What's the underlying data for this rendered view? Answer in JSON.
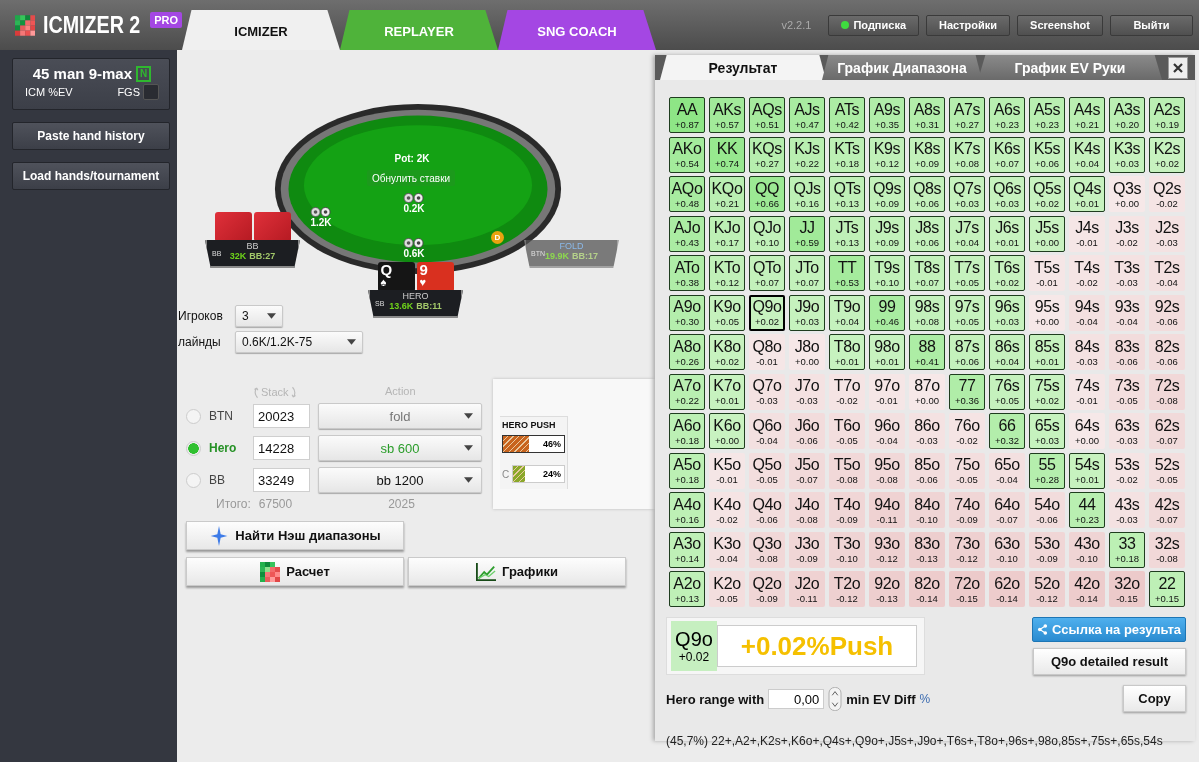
{
  "app": {
    "logo": "ICMIZER 2",
    "badge": "PRO",
    "version": "v2.2.1"
  },
  "main_tabs": [
    {
      "label": "ICMIZER",
      "selected": true,
      "color": "#f0f0f0"
    },
    {
      "label": "REPLAYER",
      "selected": false,
      "color": "#4fb33a"
    },
    {
      "label": "SNG COACH",
      "selected": false,
      "color": "#a447e3"
    }
  ],
  "top_buttons": [
    {
      "label": "Подписка",
      "kind": "status"
    },
    {
      "label": "Настройки",
      "kind": "plain"
    },
    {
      "label": "Screenshot",
      "kind": "plain"
    },
    {
      "label": "Выйти",
      "kind": "plain"
    }
  ],
  "sidebar": {
    "format": {
      "title": "45 man 9-max",
      "badge": "N",
      "subtitle": "ICM %EV",
      "fgs_label": "FGS",
      "fgs_checked": false
    },
    "buttons": [
      "Paste hand history",
      "Load hands/tournament"
    ]
  },
  "table": {
    "pot": "Pot: 2K",
    "reset_button": "Обнулить ставки",
    "dealer": "D",
    "bets": [
      {
        "amount": "1.2K"
      },
      {
        "amount": "0.2K"
      },
      {
        "amount": "0.6K"
      }
    ],
    "seats": [
      {
        "position": "BB",
        "name": "BB",
        "stack": "32K",
        "bb": "BB:27",
        "folded": false,
        "cards": [
          {
            "face_up": false
          },
          {
            "face_up": false
          }
        ]
      },
      {
        "position": "BTN",
        "name": "FOLD",
        "stack": "19.9K",
        "bb": "BB:17",
        "folded": true
      },
      {
        "position": "SB",
        "name": "HERO",
        "stack": "13.6K",
        "bb": "BB:11",
        "folded": false,
        "cards": [
          {
            "face_up": true,
            "rank": "Q",
            "suit": "♠",
            "color": "#151515"
          },
          {
            "face_up": true,
            "rank": "9",
            "suit": "♥",
            "color": "#d9301f"
          }
        ]
      }
    ]
  },
  "settings": [
    {
      "label": "Игроков",
      "value": "3",
      "kind": "short"
    },
    {
      "label": "лайнды",
      "value": "0.6K/1.2K-75",
      "kind": "wide"
    }
  ],
  "players_form": {
    "stack_header": "Stack",
    "action_header": "Action",
    "players": [
      {
        "name": "BTN",
        "selected": false,
        "stack": "20023",
        "action": "fold",
        "disabled": true
      },
      {
        "name": "Hero",
        "selected": true,
        "stack": "14228",
        "action": "sb 600",
        "disabled": false
      },
      {
        "name": "BB",
        "selected": false,
        "stack": "33249",
        "action": "bb 1200",
        "disabled": false
      }
    ],
    "totals_label": "Итого:",
    "total_stack": "67500",
    "total_action": "2025"
  },
  "range_legend": {
    "title": "HERO PUSH",
    "bars": [
      {
        "value": "46%",
        "color": "#c8641e"
      },
      {
        "label": "C",
        "value": "24%",
        "color": "#8aa82a"
      }
    ]
  },
  "actions": [
    {
      "label": "Найти Нэш диапазоны",
      "kind": "nash"
    },
    {
      "label": "Расчет",
      "kind": "calc"
    },
    {
      "label": "Графики",
      "kind": "charts"
    }
  ],
  "result_tabs": [
    {
      "label": "Результат",
      "selected": true
    },
    {
      "label": "График Диапазона",
      "selected": false
    },
    {
      "label": "График EV Руки",
      "selected": false
    }
  ],
  "grid": {
    "rows": [
      [
        {
          "hand": "AA",
          "ev": "+0.87",
          "push": true,
          "selected": false
        },
        {
          "hand": "AKs",
          "ev": "+0.57",
          "push": true,
          "selected": false
        },
        {
          "hand": "AQs",
          "ev": "+0.51",
          "push": true,
          "selected": false
        },
        {
          "hand": "AJs",
          "ev": "+0.47",
          "push": true,
          "selected": false
        },
        {
          "hand": "ATs",
          "ev": "+0.42",
          "push": true,
          "selected": false
        },
        {
          "hand": "A9s",
          "ev": "+0.35",
          "push": true,
          "selected": false
        },
        {
          "hand": "A8s",
          "ev": "+0.31",
          "push": true,
          "selected": false
        },
        {
          "hand": "A7s",
          "ev": "+0.27",
          "push": true,
          "selected": false
        },
        {
          "hand": "A6s",
          "ev": "+0.23",
          "push": true,
          "selected": false
        },
        {
          "hand": "A5s",
          "ev": "+0.23",
          "push": true,
          "selected": false
        },
        {
          "hand": "A4s",
          "ev": "+0.21",
          "push": true,
          "selected": false
        },
        {
          "hand": "A3s",
          "ev": "+0.20",
          "push": true,
          "selected": false
        },
        {
          "hand": "A2s",
          "ev": "+0.19",
          "push": true,
          "selected": false
        }
      ],
      [
        {
          "hand": "AKo",
          "ev": "+0.54",
          "push": true,
          "selected": false
        },
        {
          "hand": "KK",
          "ev": "+0.74",
          "push": true,
          "selected": false
        },
        {
          "hand": "KQs",
          "ev": "+0.27",
          "push": true,
          "selected": false
        },
        {
          "hand": "KJs",
          "ev": "+0.22",
          "push": true,
          "selected": false
        },
        {
          "hand": "KTs",
          "ev": "+0.18",
          "push": true,
          "selected": false
        },
        {
          "hand": "K9s",
          "ev": "+0.12",
          "push": true,
          "selected": false
        },
        {
          "hand": "K8s",
          "ev": "+0.09",
          "push": true,
          "selected": false
        },
        {
          "hand": "K7s",
          "ev": "+0.08",
          "push": true,
          "selected": false
        },
        {
          "hand": "K6s",
          "ev": "+0.07",
          "push": true,
          "selected": false
        },
        {
          "hand": "K5s",
          "ev": "+0.06",
          "push": true,
          "selected": false
        },
        {
          "hand": "K4s",
          "ev": "+0.04",
          "push": true,
          "selected": false
        },
        {
          "hand": "K3s",
          "ev": "+0.03",
          "push": true,
          "selected": false
        },
        {
          "hand": "K2s",
          "ev": "+0.02",
          "push": true,
          "selected": false
        }
      ],
      [
        {
          "hand": "AQo",
          "ev": "+0.48",
          "push": true,
          "selected": false
        },
        {
          "hand": "KQo",
          "ev": "+0.21",
          "push": true,
          "selected": false
        },
        {
          "hand": "QQ",
          "ev": "+0.66",
          "push": true,
          "selected": false
        },
        {
          "hand": "QJs",
          "ev": "+0.16",
          "push": true,
          "selected": false
        },
        {
          "hand": "QTs",
          "ev": "+0.13",
          "push": true,
          "selected": false
        },
        {
          "hand": "Q9s",
          "ev": "+0.09",
          "push": true,
          "selected": false
        },
        {
          "hand": "Q8s",
          "ev": "+0.06",
          "push": true,
          "selected": false
        },
        {
          "hand": "Q7s",
          "ev": "+0.03",
          "push": true,
          "selected": false
        },
        {
          "hand": "Q6s",
          "ev": "+0.03",
          "push": true,
          "selected": false
        },
        {
          "hand": "Q5s",
          "ev": "+0.02",
          "push": true,
          "selected": false
        },
        {
          "hand": "Q4s",
          "ev": "+0.01",
          "push": true,
          "selected": false
        },
        {
          "hand": "Q3s",
          "ev": "+0.00",
          "push": false,
          "selected": false
        },
        {
          "hand": "Q2s",
          "ev": "-0.02",
          "push": false,
          "selected": false
        }
      ],
      [
        {
          "hand": "AJo",
          "ev": "+0.43",
          "push": true,
          "selected": false
        },
        {
          "hand": "KJo",
          "ev": "+0.17",
          "push": true,
          "selected": false
        },
        {
          "hand": "QJo",
          "ev": "+0.10",
          "push": true,
          "selected": false
        },
        {
          "hand": "JJ",
          "ev": "+0.59",
          "push": true,
          "selected": false
        },
        {
          "hand": "JTs",
          "ev": "+0.13",
          "push": true,
          "selected": false
        },
        {
          "hand": "J9s",
          "ev": "+0.09",
          "push": true,
          "selected": false
        },
        {
          "hand": "J8s",
          "ev": "+0.06",
          "push": true,
          "selected": false
        },
        {
          "hand": "J7s",
          "ev": "+0.04",
          "push": true,
          "selected": false
        },
        {
          "hand": "J6s",
          "ev": "+0.01",
          "push": true,
          "selected": false
        },
        {
          "hand": "J5s",
          "ev": "+0.00",
          "push": true,
          "selected": false
        },
        {
          "hand": "J4s",
          "ev": "-0.01",
          "push": false,
          "selected": false
        },
        {
          "hand": "J3s",
          "ev": "-0.02",
          "push": false,
          "selected": false
        },
        {
          "hand": "J2s",
          "ev": "-0.03",
          "push": false,
          "selected": false
        }
      ],
      [
        {
          "hand": "ATo",
          "ev": "+0.38",
          "push": true,
          "selected": false
        },
        {
          "hand": "KTo",
          "ev": "+0.12",
          "push": true,
          "selected": false
        },
        {
          "hand": "QTo",
          "ev": "+0.07",
          "push": true,
          "selected": false
        },
        {
          "hand": "JTo",
          "ev": "+0.07",
          "push": true,
          "selected": false
        },
        {
          "hand": "TT",
          "ev": "+0.53",
          "push": true,
          "selected": false
        },
        {
          "hand": "T9s",
          "ev": "+0.10",
          "push": true,
          "selected": false
        },
        {
          "hand": "T8s",
          "ev": "+0.07",
          "push": true,
          "selected": false
        },
        {
          "hand": "T7s",
          "ev": "+0.05",
          "push": true,
          "selected": false
        },
        {
          "hand": "T6s",
          "ev": "+0.02",
          "push": true,
          "selected": false
        },
        {
          "hand": "T5s",
          "ev": "-0.01",
          "push": false,
          "selected": false
        },
        {
          "hand": "T4s",
          "ev": "-0.02",
          "push": false,
          "selected": false
        },
        {
          "hand": "T3s",
          "ev": "-0.03",
          "push": false,
          "selected": false
        },
        {
          "hand": "T2s",
          "ev": "-0.04",
          "push": false,
          "selected": false
        }
      ],
      [
        {
          "hand": "A9o",
          "ev": "+0.30",
          "push": true,
          "selected": false
        },
        {
          "hand": "K9o",
          "ev": "+0.05",
          "push": true,
          "selected": false
        },
        {
          "hand": "Q9o",
          "ev": "+0.02",
          "push": true,
          "selected": true
        },
        {
          "hand": "J9o",
          "ev": "+0.03",
          "push": true,
          "selected": false
        },
        {
          "hand": "T9o",
          "ev": "+0.04",
          "push": true,
          "selected": false
        },
        {
          "hand": "99",
          "ev": "+0.46",
          "push": true,
          "selected": false
        },
        {
          "hand": "98s",
          "ev": "+0.08",
          "push": true,
          "selected": false
        },
        {
          "hand": "97s",
          "ev": "+0.05",
          "push": true,
          "selected": false
        },
        {
          "hand": "96s",
          "ev": "+0.03",
          "push": true,
          "selected": false
        },
        {
          "hand": "95s",
          "ev": "+0.00",
          "push": false,
          "selected": false
        },
        {
          "hand": "94s",
          "ev": "-0.04",
          "push": false,
          "selected": false
        },
        {
          "hand": "93s",
          "ev": "-0.04",
          "push": false,
          "selected": false
        },
        {
          "hand": "92s",
          "ev": "-0.06",
          "push": false,
          "selected": false
        }
      ],
      [
        {
          "hand": "A8o",
          "ev": "+0.26",
          "push": true,
          "selected": false
        },
        {
          "hand": "K8o",
          "ev": "+0.02",
          "push": true,
          "selected": false
        },
        {
          "hand": "Q8o",
          "ev": "-0.01",
          "push": false,
          "selected": false
        },
        {
          "hand": "J8o",
          "ev": "+0.00",
          "push": false,
          "selected": false
        },
        {
          "hand": "T8o",
          "ev": "+0.01",
          "push": true,
          "selected": false
        },
        {
          "hand": "98o",
          "ev": "+0.01",
          "push": true,
          "selected": false
        },
        {
          "hand": "88",
          "ev": "+0.41",
          "push": true,
          "selected": false
        },
        {
          "hand": "87s",
          "ev": "+0.06",
          "push": true,
          "selected": false
        },
        {
          "hand": "86s",
          "ev": "+0.04",
          "push": true,
          "selected": false
        },
        {
          "hand": "85s",
          "ev": "+0.01",
          "push": true,
          "selected": false
        },
        {
          "hand": "84s",
          "ev": "-0.03",
          "push": false,
          "selected": false
        },
        {
          "hand": "83s",
          "ev": "-0.06",
          "push": false,
          "selected": false
        },
        {
          "hand": "82s",
          "ev": "-0.06",
          "push": false,
          "selected": false
        }
      ],
      [
        {
          "hand": "A7o",
          "ev": "+0.22",
          "push": true,
          "selected": false
        },
        {
          "hand": "K7o",
          "ev": "+0.01",
          "push": true,
          "selected": false
        },
        {
          "hand": "Q7o",
          "ev": "-0.03",
          "push": false,
          "selected": false
        },
        {
          "hand": "J7o",
          "ev": "-0.03",
          "push": false,
          "selected": false
        },
        {
          "hand": "T7o",
          "ev": "-0.02",
          "push": false,
          "selected": false
        },
        {
          "hand": "97o",
          "ev": "-0.01",
          "push": false,
          "selected": false
        },
        {
          "hand": "87o",
          "ev": "+0.00",
          "push": false,
          "selected": false
        },
        {
          "hand": "77",
          "ev": "+0.36",
          "push": true,
          "selected": false
        },
        {
          "hand": "76s",
          "ev": "+0.05",
          "push": true,
          "selected": false
        },
        {
          "hand": "75s",
          "ev": "+0.02",
          "push": true,
          "selected": false
        },
        {
          "hand": "74s",
          "ev": "-0.01",
          "push": false,
          "selected": false
        },
        {
          "hand": "73s",
          "ev": "-0.05",
          "push": false,
          "selected": false
        },
        {
          "hand": "72s",
          "ev": "-0.08",
          "push": false,
          "selected": false
        }
      ],
      [
        {
          "hand": "A6o",
          "ev": "+0.18",
          "push": true,
          "selected": false
        },
        {
          "hand": "K6o",
          "ev": "+0.00",
          "push": true,
          "selected": false
        },
        {
          "hand": "Q6o",
          "ev": "-0.04",
          "push": false,
          "selected": false
        },
        {
          "hand": "J6o",
          "ev": "-0.06",
          "push": false,
          "selected": false
        },
        {
          "hand": "T6o",
          "ev": "-0.05",
          "push": false,
          "selected": false
        },
        {
          "hand": "96o",
          "ev": "-0.04",
          "push": false,
          "selected": false
        },
        {
          "hand": "86o",
          "ev": "-0.03",
          "push": false,
          "selected": false
        },
        {
          "hand": "76o",
          "ev": "-0.02",
          "push": false,
          "selected": false
        },
        {
          "hand": "66",
          "ev": "+0.32",
          "push": true,
          "selected": false
        },
        {
          "hand": "65s",
          "ev": "+0.03",
          "push": true,
          "selected": false
        },
        {
          "hand": "64s",
          "ev": "+0.00",
          "push": false,
          "selected": false
        },
        {
          "hand": "63s",
          "ev": "-0.03",
          "push": false,
          "selected": false
        },
        {
          "hand": "62s",
          "ev": "-0.07",
          "push": false,
          "selected": false
        }
      ],
      [
        {
          "hand": "A5o",
          "ev": "+0.18",
          "push": true,
          "selected": false
        },
        {
          "hand": "K5o",
          "ev": "-0.01",
          "push": false,
          "selected": false
        },
        {
          "hand": "Q5o",
          "ev": "-0.05",
          "push": false,
          "selected": false
        },
        {
          "hand": "J5o",
          "ev": "-0.07",
          "push": false,
          "selected": false
        },
        {
          "hand": "T5o",
          "ev": "-0.08",
          "push": false,
          "selected": false
        },
        {
          "hand": "95o",
          "ev": "-0.08",
          "push": false,
          "selected": false
        },
        {
          "hand": "85o",
          "ev": "-0.06",
          "push": false,
          "selected": false
        },
        {
          "hand": "75o",
          "ev": "-0.05",
          "push": false,
          "selected": false
        },
        {
          "hand": "65o",
          "ev": "-0.04",
          "push": false,
          "selected": false
        },
        {
          "hand": "55",
          "ev": "+0.28",
          "push": true,
          "selected": false
        },
        {
          "hand": "54s",
          "ev": "+0.01",
          "push": true,
          "selected": false
        },
        {
          "hand": "53s",
          "ev": "-0.02",
          "push": false,
          "selected": false
        },
        {
          "hand": "52s",
          "ev": "-0.05",
          "push": false,
          "selected": false
        }
      ],
      [
        {
          "hand": "A4o",
          "ev": "+0.16",
          "push": true,
          "selected": false
        },
        {
          "hand": "K4o",
          "ev": "-0.02",
          "push": false,
          "selected": false
        },
        {
          "hand": "Q4o",
          "ev": "-0.06",
          "push": false,
          "selected": false
        },
        {
          "hand": "J4o",
          "ev": "-0.08",
          "push": false,
          "selected": false
        },
        {
          "hand": "T4o",
          "ev": "-0.09",
          "push": false,
          "selected": false
        },
        {
          "hand": "94o",
          "ev": "-0.11",
          "push": false,
          "selected": false
        },
        {
          "hand": "84o",
          "ev": "-0.10",
          "push": false,
          "selected": false
        },
        {
          "hand": "74o",
          "ev": "-0.09",
          "push": false,
          "selected": false
        },
        {
          "hand": "64o",
          "ev": "-0.07",
          "push": false,
          "selected": false
        },
        {
          "hand": "54o",
          "ev": "-0.06",
          "push": false,
          "selected": false
        },
        {
          "hand": "44",
          "ev": "+0.23",
          "push": true,
          "selected": false
        },
        {
          "hand": "43s",
          "ev": "-0.03",
          "push": false,
          "selected": false
        },
        {
          "hand": "42s",
          "ev": "-0.07",
          "push": false,
          "selected": false
        }
      ],
      [
        {
          "hand": "A3o",
          "ev": "+0.14",
          "push": true,
          "selected": false
        },
        {
          "hand": "K3o",
          "ev": "-0.04",
          "push": false,
          "selected": false
        },
        {
          "hand": "Q3o",
          "ev": "-0.08",
          "push": false,
          "selected": false
        },
        {
          "hand": "J3o",
          "ev": "-0.09",
          "push": false,
          "selected": false
        },
        {
          "hand": "T3o",
          "ev": "-0.10",
          "push": false,
          "selected": false
        },
        {
          "hand": "93o",
          "ev": "-0.12",
          "push": false,
          "selected": false
        },
        {
          "hand": "83o",
          "ev": "-0.13",
          "push": false,
          "selected": false
        },
        {
          "hand": "73o",
          "ev": "-0.12",
          "push": false,
          "selected": false
        },
        {
          "hand": "63o",
          "ev": "-0.10",
          "push": false,
          "selected": false
        },
        {
          "hand": "53o",
          "ev": "-0.09",
          "push": false,
          "selected": false
        },
        {
          "hand": "43o",
          "ev": "-0.10",
          "push": false,
          "selected": false
        },
        {
          "hand": "33",
          "ev": "+0.18",
          "push": true,
          "selected": false
        },
        {
          "hand": "32s",
          "ev": "-0.08",
          "push": false,
          "selected": false
        }
      ],
      [
        {
          "hand": "A2o",
          "ev": "+0.13",
          "push": true,
          "selected": false
        },
        {
          "hand": "K2o",
          "ev": "-0.05",
          "push": false,
          "selected": false
        },
        {
          "hand": "Q2o",
          "ev": "-0.09",
          "push": false,
          "selected": false
        },
        {
          "hand": "J2o",
          "ev": "-0.11",
          "push": false,
          "selected": false
        },
        {
          "hand": "T2o",
          "ev": "-0.12",
          "push": false,
          "selected": false
        },
        {
          "hand": "92o",
          "ev": "-0.13",
          "push": false,
          "selected": false
        },
        {
          "hand": "82o",
          "ev": "-0.14",
          "push": false,
          "selected": false
        },
        {
          "hand": "72o",
          "ev": "-0.15",
          "push": false,
          "selected": false
        },
        {
          "hand": "62o",
          "ev": "-0.14",
          "push": false,
          "selected": false
        },
        {
          "hand": "52o",
          "ev": "-0.12",
          "push": false,
          "selected": false
        },
        {
          "hand": "42o",
          "ev": "-0.14",
          "push": false,
          "selected": false
        },
        {
          "hand": "32o",
          "ev": "-0.15",
          "push": false,
          "selected": false
        },
        {
          "hand": "22",
          "ev": "+0.15",
          "push": true,
          "selected": false
        }
      ]
    ]
  },
  "selected_hand": {
    "hand": "Q9o",
    "ev": "+0.02",
    "push": true,
    "result": "+0.02%Push"
  },
  "share_button": "Ссылка на результа",
  "detail_button": "Q9o detailed result",
  "range_filter": {
    "label": "Hero range with",
    "value": "0,00",
    "suffix": "min EV Diff",
    "unit": "%"
  },
  "copy_button": "Copy",
  "range_text": "(45,7%) 22+,A2+,K2s+,K6o+,Q4s+,Q9o+,J5s+,J9o+,T6s+,T8o+,96s+,98o,85s+,75s+,65s,54s"
}
